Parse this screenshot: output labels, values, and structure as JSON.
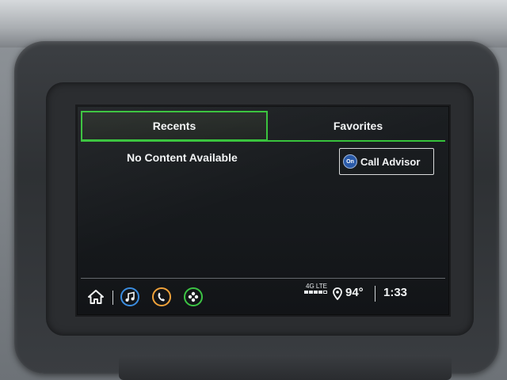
{
  "tabs": [
    {
      "label": "Recents",
      "selected": true
    },
    {
      "label": "Favorites",
      "selected": false
    }
  ],
  "content": {
    "empty_message": "No Content Available"
  },
  "advisor_button": {
    "icon_text": "On",
    "label": "Call Advisor"
  },
  "bottom_nav": {
    "items": [
      "home-icon",
      "audio-icon",
      "phone-icon",
      "apps-icon"
    ]
  },
  "status": {
    "network": "4G LTE",
    "signal_bars": 4,
    "signal_max": 5,
    "temperature": "94°",
    "time": "1:33"
  },
  "colors": {
    "selected_tab": "#36c23a",
    "audio": "#3b8de0",
    "phone": "#f0a23a",
    "apps": "#3cc444"
  }
}
